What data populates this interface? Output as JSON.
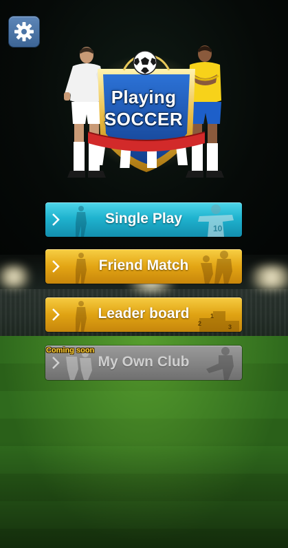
{
  "logo": {
    "line1": "Playing",
    "line2": "SOCCER"
  },
  "settings": {
    "icon": "gear-icon"
  },
  "menu": {
    "single_play": {
      "label": "Single Play",
      "color": "#1fb3cf"
    },
    "friend_match": {
      "label": "Friend Match",
      "color": "#e3a514"
    },
    "leader_board": {
      "label": "Leader board",
      "color": "#e0a313",
      "podium": [
        "1",
        "2",
        "3"
      ]
    },
    "my_own_club": {
      "label": "My Own Club",
      "badge": "Coming soon",
      "color": "#858585",
      "enabled": false
    }
  }
}
